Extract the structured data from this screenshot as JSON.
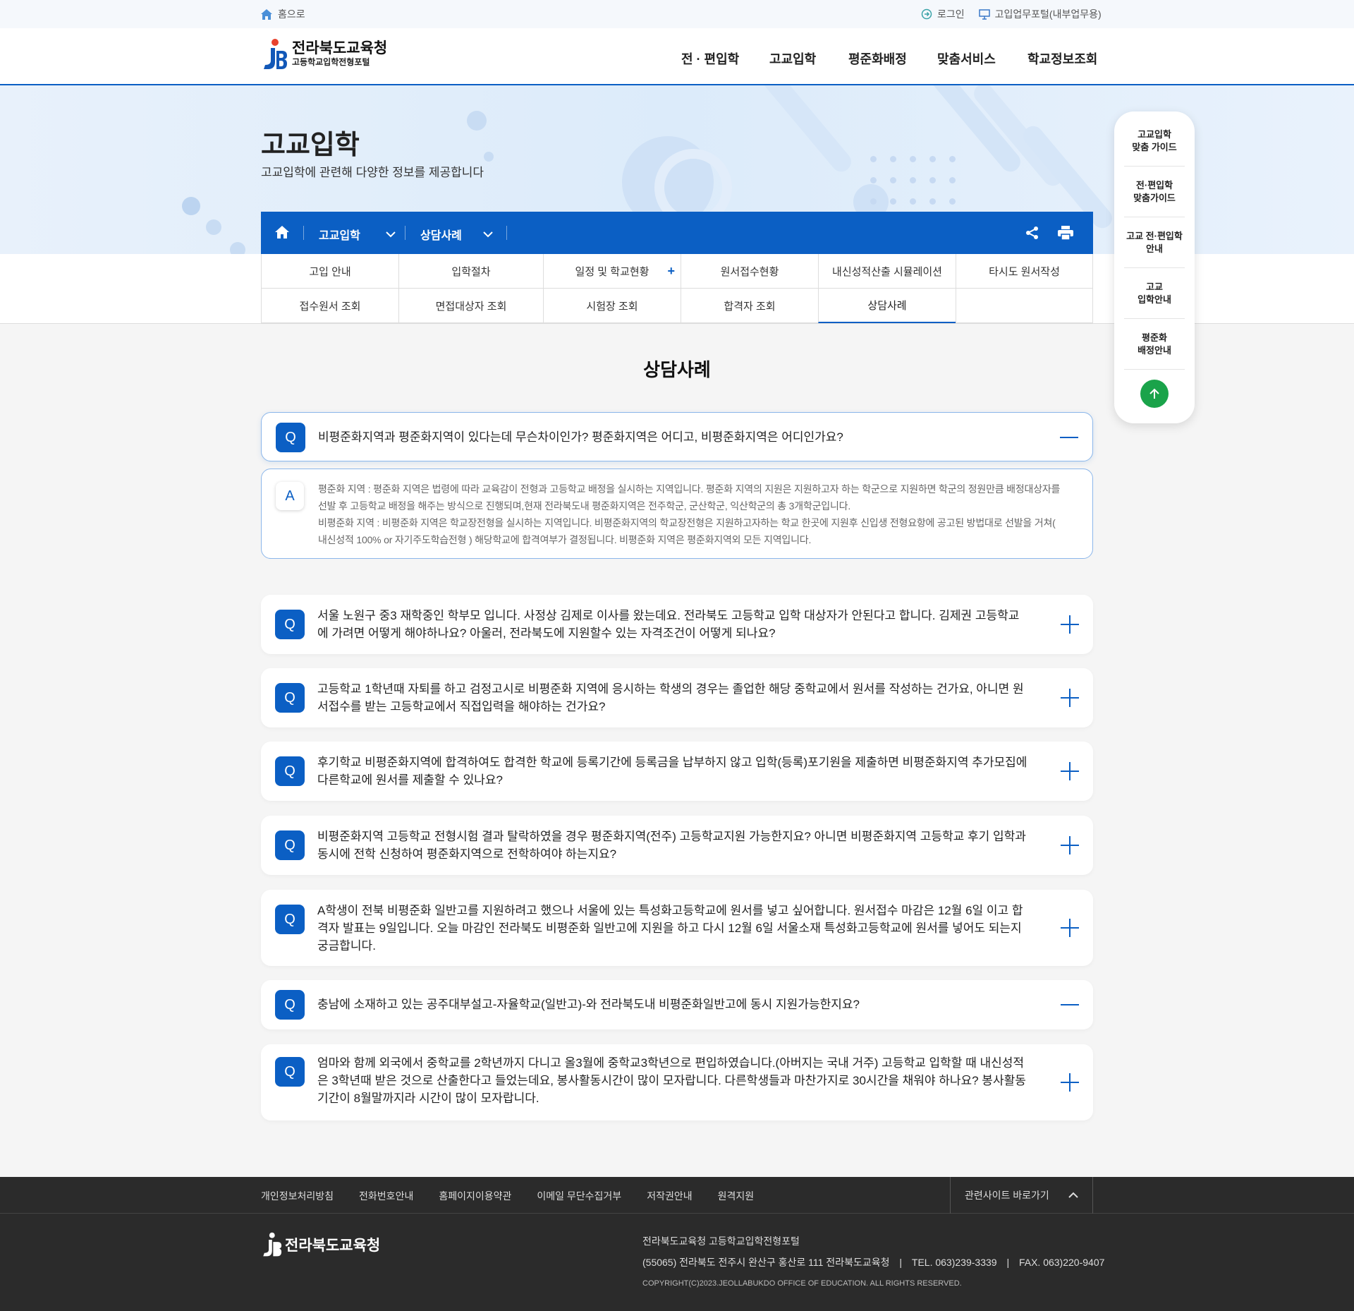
{
  "topbar": {
    "home": "홈으로",
    "login": "로그인",
    "portal": "고입업무포털(내부업무용)"
  },
  "logo": {
    "title": "전라북도교육청",
    "subtitle": "고등학교입학전형포털"
  },
  "gnb": [
    "전 · 편입학",
    "고교입학",
    "평준화배정",
    "맞춤서비스",
    "학교정보조회"
  ],
  "hero": {
    "title": "고교입학",
    "subtitle": "고교입학에 관련해 다양한 정보를 제공합니다"
  },
  "location": {
    "level1": "고교입학",
    "level2": "상담사례"
  },
  "submenu": [
    [
      "고입 안내",
      "입학절차",
      "일정 및 학교현황",
      "원서접수현황",
      "내신성적산출 시뮬레이션",
      "타시도 원서작성"
    ],
    [
      "접수원서 조회",
      "면접대상자 조회",
      "시험장 조회",
      "합격자 조회",
      "상담사례",
      ""
    ]
  ],
  "sidebar": [
    "고교입학\n맞춤 가이드",
    "전·편입학\n맞춤가이드",
    "고교 전·편입학\n안내",
    "고교\n입학안내",
    "평준화\n배정안내"
  ],
  "section_title": "상담사례",
  "badges": {
    "q": "Q",
    "a": "A"
  },
  "faqs": [
    {
      "q": "비평준화지역과 평준화지역이 있다는데 무슨차이인가? 평준화지역은 어디고, 비평준화지역은 어디인가요?",
      "open": true
    },
    {
      "q": "서울 노원구 중3 재학중인 학부모 입니다. 사정상 김제로 이사를 왔는데요. 전라북도 고등학교 입학 대상자가 안된다고 합니다. 김제권 고등학교에 가려면 어떻게 해야하나요? 아울러, 전라북도에 지원할수 있는 자격조건이 어떻게 되나요?",
      "open": false
    },
    {
      "q": "고등학교 1학년때 자퇴를 하고 검정고시로 비평준화 지역에 응시하는 학생의 경우는 졸업한 해당 중학교에서 원서를 작성하는 건가요, 아니면 원서접수를 받는 고등학교에서 직접입력을 해야하는 건가요?",
      "open": false
    },
    {
      "q": "후기학교 비평준화지역에 합격하여도 합격한 학교에 등록기간에 등록금을 납부하지 않고 입학(등록)포기원을 제출하면 비평준화지역 추가모집에 다른학교에 원서를 제출할 수 있나요?",
      "open": false
    },
    {
      "q": "비평준화지역 고등학교 전형시험 결과 탈락하였을 경우 평준화지역(전주) 고등학교지원 가능한지요? 아니면 비평준화지역 고등학교 후기 입학과 동시에 전학 신청하여 평준화지역으로 전학하여야 하는지요?",
      "open": false
    },
    {
      "q": "A학생이 전북 비평준화 일반고를 지원하려고 했으나 서울에 있는 특성화고등학교에 원서를 넣고 싶어합니다. 원서접수 마감은 12월 6일 이고 합격자 발표는 9일입니다. 오늘 마감인 전라북도 비평준화 일반고에 지원을 하고 다시 12월 6일 서울소재 특성화고등학교에 원서를 넣어도 되는지 궁금합니다.",
      "open": false
    },
    {
      "q": "충남에 소재하고 있는 공주대부설고-자율학교(일반고)-와 전라북도내 비평준화일반고에 동시 지원가능한지요?",
      "open": true
    },
    {
      "q": "엄마와 함께 외국에서 중학교를 2학년까지 다니고 올3월에 중학교3학년으로 편입하였습니다.(아버지는 국내 거주) 고등학교 입학할 때 내신성적은 3학년때 받은 것으로 산출한다고 들었는데요, 봉사활동시간이 많이 모자랍니다. 다른학생들과 마찬가지로 30시간을 채워야 하나요? 봉사활동기간이 8월말까지라 시간이 많이 모자랍니다.",
      "open": false
    }
  ],
  "answer": {
    "line1": "평준화 지역 : 평준화 지역은 법령에 따라 교육감이 전형과 고등학교 배정을 실시하는 지역입니다. 평준화 지역의 지원은 지원하고자 하는 학군으로 지원하면 학군의 정원만큼 배정대상자를 선발 후 고등학교 배정을 해주는 방식으로 진행되며,현재 전라북도내 평준화지역은 전주학군, 군산학군, 익산학군의 총 3개학군입니다.",
    "line2": "비평준화 지역 : 비평준화 지역은 학교장전형을 실시하는 지역입니다. 비평준화지역의 학교장전형은 지원하고자하는 학교 한곳에 지원후 신입생 전형요항에 공고된 방법대로 선발을 거쳐( 내신성적 100% or 자기주도학습전형 ) 해당학교에 합격여부가 결정됩니다. 비평준화 지역은 평준화지역외 모든 지역입니다."
  },
  "footer": {
    "links": [
      "개인정보처리방침",
      "전화번호안내",
      "홈페이지이용약관",
      "이메일 무단수집거부",
      "저작권안내",
      "원격지원"
    ],
    "related": "관련사이트 바로가기",
    "logo": "전라북도교육청",
    "org": "전라북도교육청 고등학교입학전형포털",
    "address": "(55065) 전라북도 전주시 완산구 홍산로 111 전라북도교육청",
    "tel": "TEL. 063)239-3339",
    "fax": "FAX. 063)220-9407",
    "copyright": "COPYRIGHT(C)2023.JEOLLABUKDO OFFICE OF EDUCATION. ALL RIGHTS RESERVED."
  },
  "colors": {
    "primary": "#0b5fc4",
    "up_button": "#1aa34a",
    "footer": "#2b2b2b"
  }
}
